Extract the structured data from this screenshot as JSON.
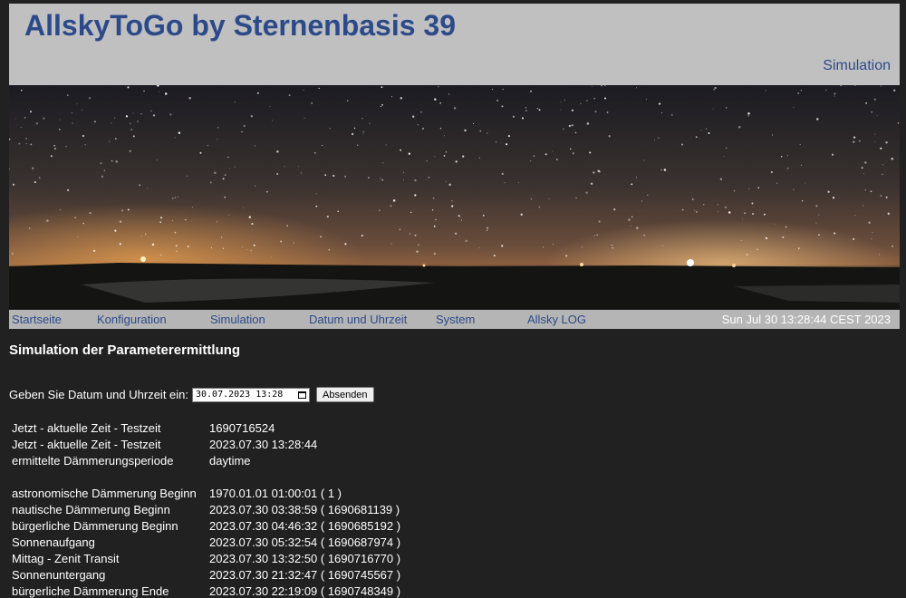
{
  "header": {
    "title": "AllskyToGo by Sternenbasis 39",
    "page_name": "Simulation"
  },
  "nav": {
    "items": [
      "Startseite",
      "Konfiguration",
      "Simulation",
      "Datum und Uhrzeit",
      "System",
      "Allsky LOG"
    ],
    "clock": "Sun Jul 30 13:28:44 CEST 2023"
  },
  "main": {
    "heading": "Simulation der Parameterermittlung",
    "form_label": "Geben Sie Datum und Uhrzeit ein:",
    "datetime_value": "30.07.2023 13:28",
    "submit_label": "Absenden"
  },
  "info_rows": [
    {
      "label": "Jetzt - aktuelle Zeit - Testzeit",
      "value": "1690716524"
    },
    {
      "label": "Jetzt - aktuelle Zeit - Testzeit",
      "value": "2023.07.30 13:28:44"
    },
    {
      "label": "ermittelte Dämmerungsperiode",
      "value": "daytime"
    }
  ],
  "twilight_rows": [
    {
      "label": "astronomische Dämmerung Beginn",
      "value": "1970.01.01 01:00:01 ( 1 )"
    },
    {
      "label": "nautische Dämmerung Beginn",
      "value": "2023.07.30 03:38:59 ( 1690681139 )"
    },
    {
      "label": "bürgerliche Dämmerung Beginn",
      "value": "2023.07.30 04:46:32 ( 1690685192 )"
    },
    {
      "label": "Sonnenaufgang",
      "value": "2023.07.30 05:32:54 ( 1690687974 )"
    },
    {
      "label": "Mittag - Zenit Transit",
      "value": "2023.07.30 13:32:50 ( 1690716770 )"
    },
    {
      "label": "Sonnenuntergang",
      "value": "2023.07.30 21:32:47 ( 1690745567 )"
    },
    {
      "label": "bürgerliche Dämmerung Ende",
      "value": "2023.07.30 22:19:09 ( 1690748349 )"
    }
  ],
  "colors": {
    "title_blue": "#2c4a8a",
    "header_bg": "#c0c0c0",
    "nav_bg": "#b5b5b5",
    "page_bg": "#212121"
  }
}
